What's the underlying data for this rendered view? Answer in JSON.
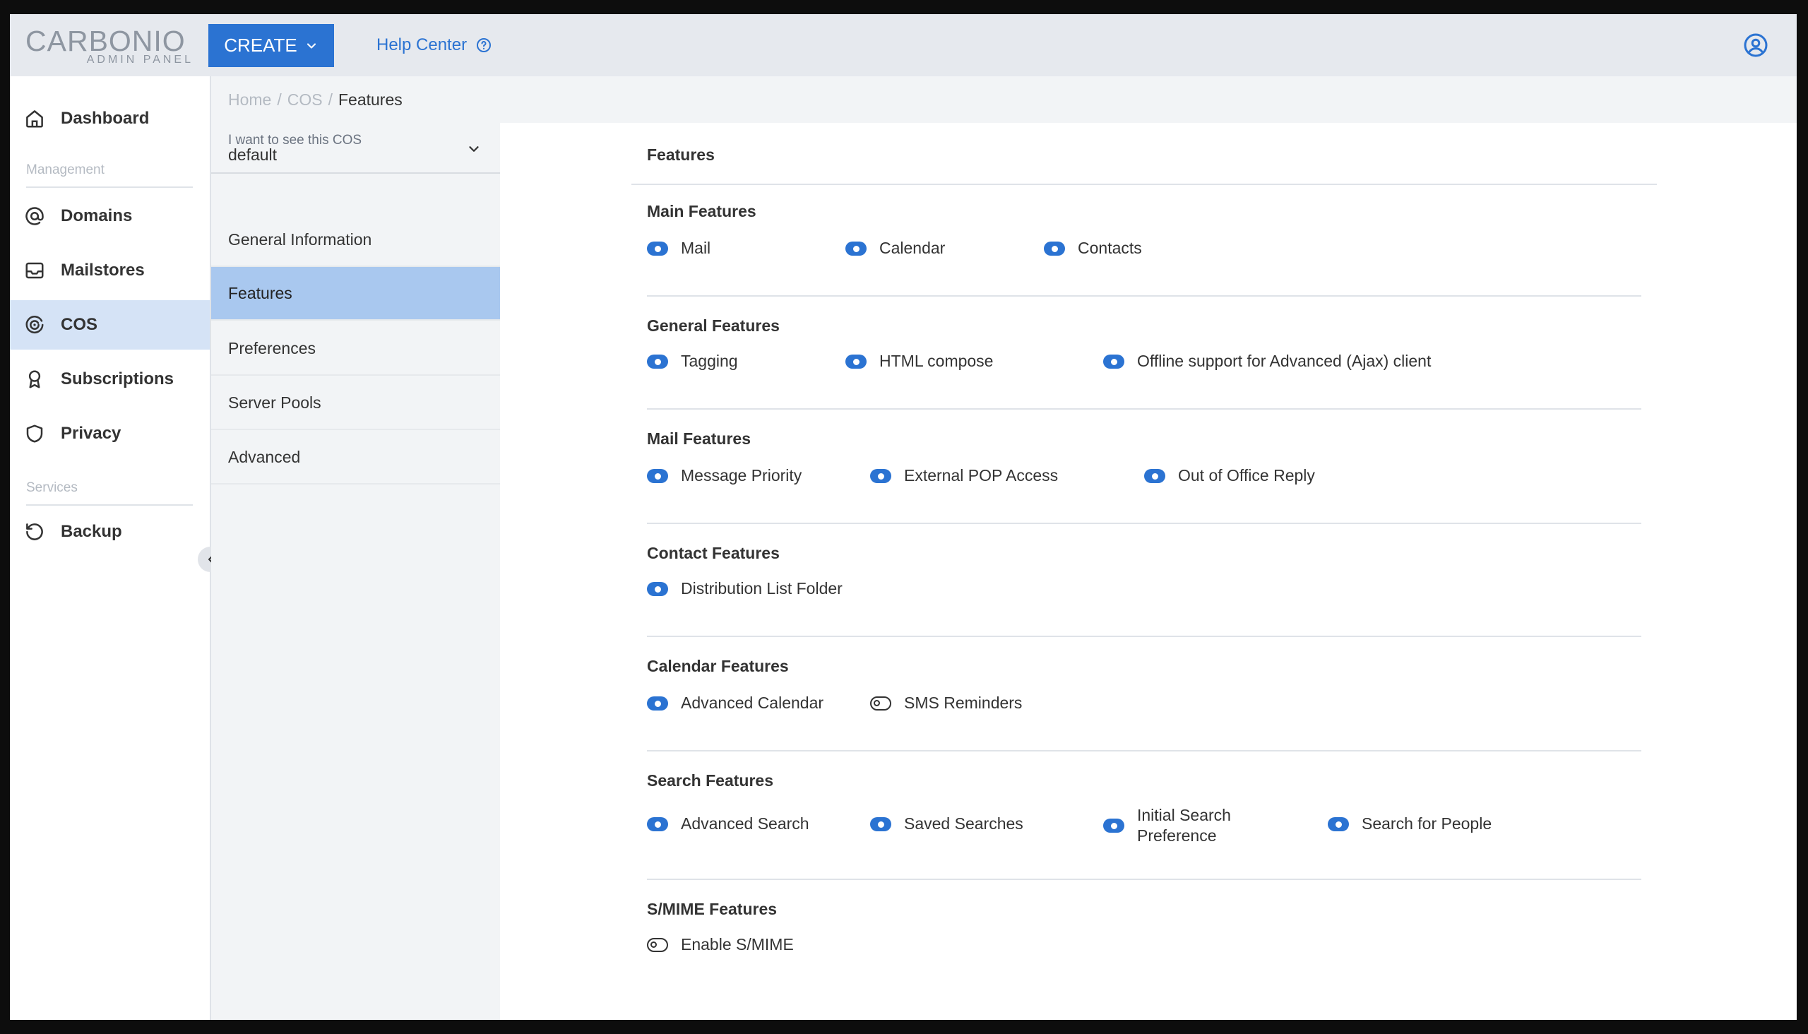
{
  "header": {
    "logo_text": "CARBONIO",
    "logo_subtitle": "ADMIN PANEL",
    "create_label": "CREATE",
    "help_label": "Help Center"
  },
  "nav": {
    "dashboard": "Dashboard",
    "section_management": "Management",
    "domains": "Domains",
    "mailstores": "Mailstores",
    "cos": "COS",
    "subscriptions": "Subscriptions",
    "privacy": "Privacy",
    "section_services": "Services",
    "backup": "Backup"
  },
  "breadcrumb": {
    "home": "Home",
    "cos": "COS",
    "current": "Features"
  },
  "cos_select": {
    "label": "I want to see this COS",
    "value": "default"
  },
  "subnav": {
    "general": "General Information",
    "features": "Features",
    "preferences": "Preferences",
    "server_pools": "Server Pools",
    "advanced": "Advanced"
  },
  "colors": {
    "accent": "#2b73d2",
    "active_nav": "#d5e3f6",
    "active_subnav": "#a9c8ef"
  },
  "main": {
    "title": "Features",
    "sections": {
      "main": {
        "title": "Main Features",
        "items": [
          {
            "label": "Mail",
            "enabled": true
          },
          {
            "label": "Calendar",
            "enabled": true
          },
          {
            "label": "Contacts",
            "enabled": true
          }
        ]
      },
      "general": {
        "title": "General Features",
        "items": [
          {
            "label": "Tagging",
            "enabled": true
          },
          {
            "label": "HTML compose",
            "enabled": true
          },
          {
            "label": "Offline support for Advanced (Ajax) client",
            "enabled": true
          }
        ]
      },
      "mail": {
        "title": "Mail Features",
        "items": [
          {
            "label": "Message Priority",
            "enabled": true
          },
          {
            "label": "External POP Access",
            "enabled": true
          },
          {
            "label": "Out of Office Reply",
            "enabled": true
          }
        ]
      },
      "contact": {
        "title": "Contact Features",
        "items": [
          {
            "label": "Distribution List Folder",
            "enabled": true
          }
        ]
      },
      "calendar": {
        "title": "Calendar Features",
        "items": [
          {
            "label": "Advanced Calendar",
            "enabled": true
          },
          {
            "label": "SMS Reminders",
            "enabled": false
          }
        ]
      },
      "search": {
        "title": "Search Features",
        "items": [
          {
            "label": "Advanced Search",
            "enabled": true
          },
          {
            "label": "Saved Searches",
            "enabled": true
          },
          {
            "label": "Initial Search",
            "label2": "Preference",
            "enabled": true
          },
          {
            "label": "Search for People",
            "enabled": true
          }
        ]
      },
      "smime": {
        "title": "S/MIME Features",
        "items": [
          {
            "label": "Enable S/MIME",
            "enabled": false
          }
        ]
      }
    }
  }
}
